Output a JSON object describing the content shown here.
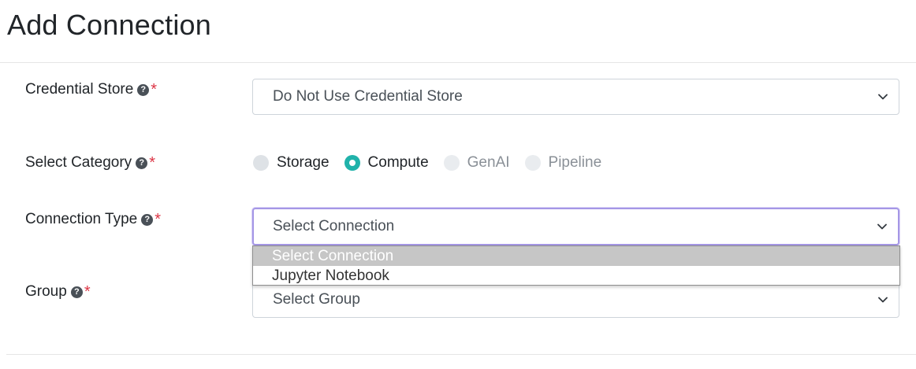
{
  "page": {
    "title": "Add Connection"
  },
  "form": {
    "credential_store": {
      "label": "Credential Store",
      "required_mark": "*",
      "help_icon": "question-circle-icon",
      "selected_value": "Do Not Use Credential Store"
    },
    "category": {
      "label": "Select Category",
      "required_mark": "*",
      "help_icon": "question-circle-icon",
      "options": [
        {
          "label": "Storage",
          "checked": false,
          "disabled": false
        },
        {
          "label": "Compute",
          "checked": true,
          "disabled": false
        },
        {
          "label": "GenAI",
          "checked": false,
          "disabled": true
        },
        {
          "label": "Pipeline",
          "checked": false,
          "disabled": true
        }
      ]
    },
    "connection_type": {
      "label": "Connection Type",
      "required_mark": "*",
      "help_icon": "question-circle-icon",
      "selected_value": "Select Connection",
      "dropdown_open": true,
      "options": [
        "Select Connection",
        "Jupyter Notebook"
      ],
      "highlighted_index": 0
    },
    "group": {
      "label": "Group",
      "required_mark": "*",
      "help_icon": "question-circle-icon",
      "selected_value": "Select Group"
    }
  },
  "colors": {
    "required": "#dc3545",
    "radio_checked": "#20b2aa",
    "focus_border": "#a597e6",
    "option_highlight": "#c6c6c6"
  }
}
